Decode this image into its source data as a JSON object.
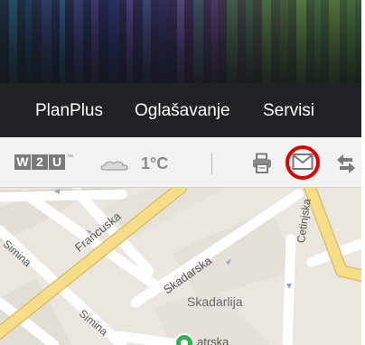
{
  "nav": {
    "items": [
      {
        "label": "PlanPlus"
      },
      {
        "label": "Oglašavanje"
      },
      {
        "label": "Servisi"
      }
    ]
  },
  "toolbar": {
    "logo": {
      "letters": [
        "W",
        "2",
        "U"
      ],
      "trademark": "™"
    },
    "weather": {
      "icon": "cloud-icon",
      "temperature": "1°C"
    },
    "icons": [
      "print-icon",
      "mail-icon",
      "share-icon"
    ]
  },
  "map": {
    "streets": [
      "Francuska",
      "Skadarska",
      "Cetinjska",
      "Simina",
      "Simina"
    ],
    "place": "Skadarlija",
    "partial": "atrska"
  },
  "colors": {
    "highlight": "#e00000",
    "nav_bg": "#202226",
    "toolbar_bg": "#f2f2f2",
    "map_bg": "#ebe7e0",
    "road_yellow": "#f6de89"
  }
}
